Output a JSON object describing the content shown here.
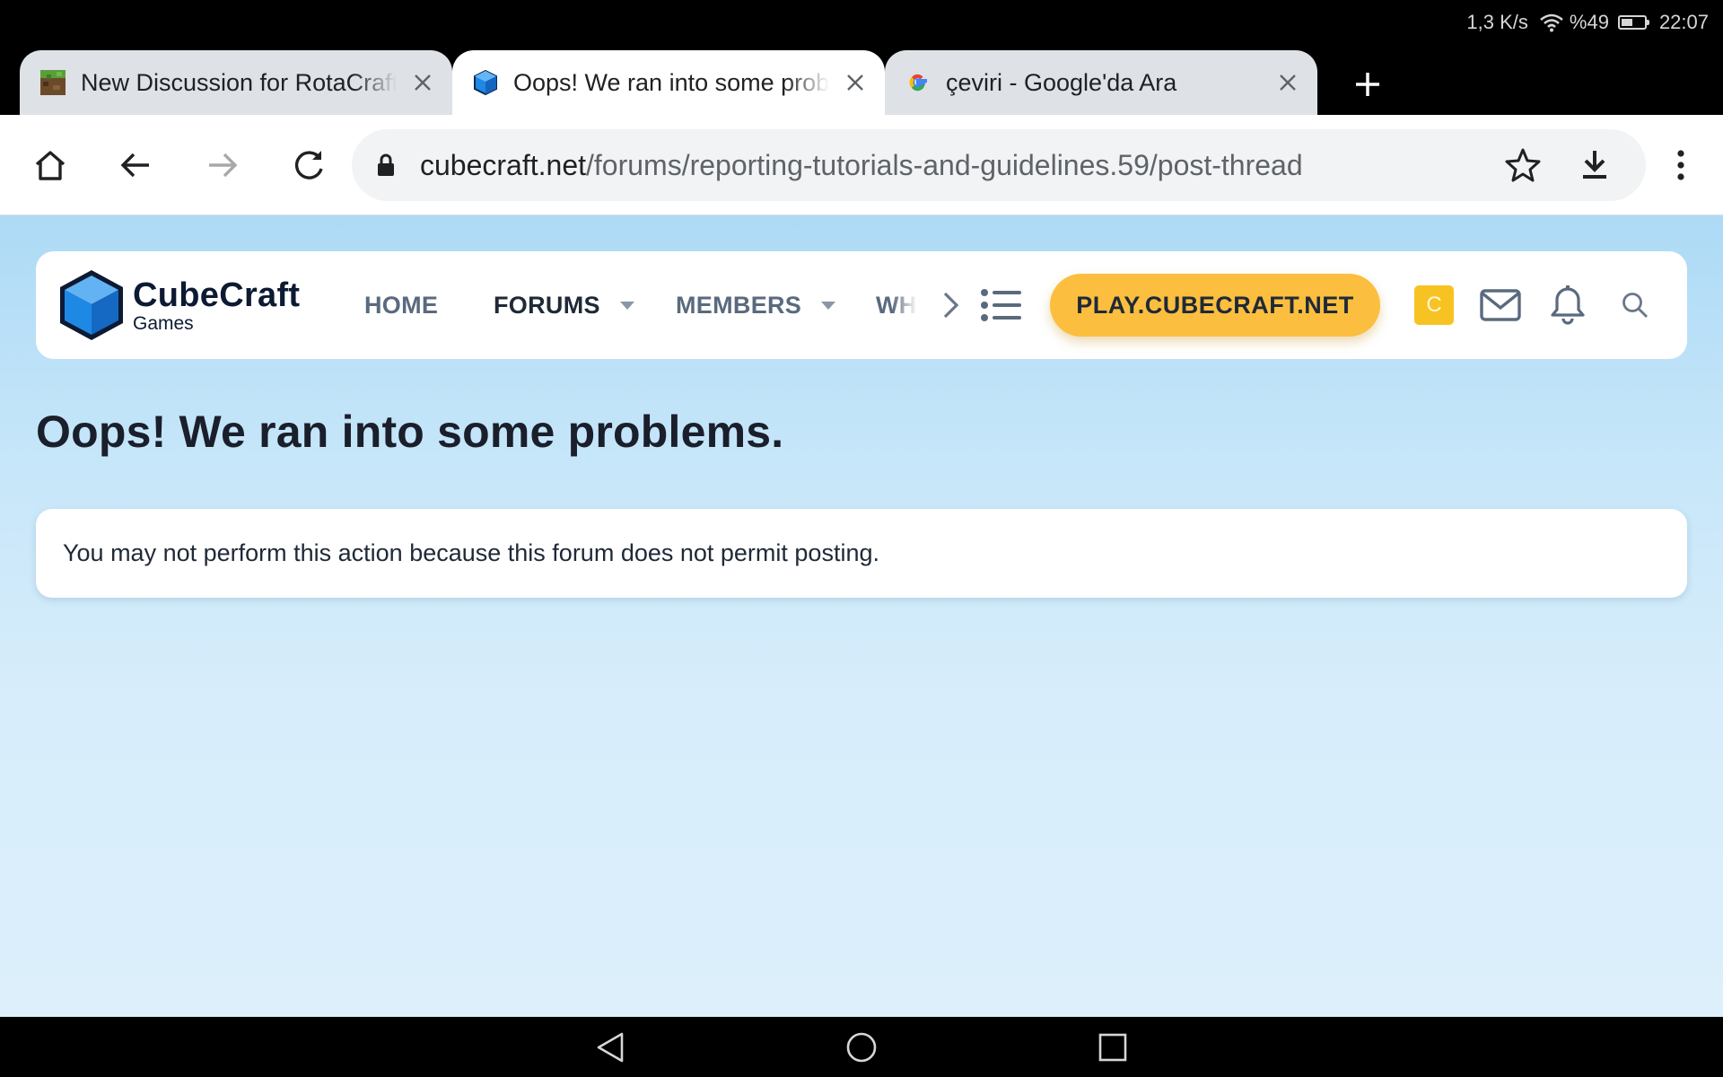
{
  "status_bar": {
    "network_speed": "1,3 K/s",
    "battery_percent": "%49",
    "battery_level": 0.49,
    "time": "22:07",
    "icons": [
      "wifi-icon",
      "battery-icon"
    ]
  },
  "tabs": [
    {
      "title": "New Discussion for RotaCraft",
      "favicon": "minecraft-block-icon",
      "active": false
    },
    {
      "title": "Oops! We ran into some problems.",
      "favicon": "cubecraft-cube-icon",
      "active": true
    },
    {
      "title": "çeviri - Google'da Ara",
      "favicon": "google-g-icon",
      "active": false
    }
  ],
  "toolbar": {
    "url_host": "cubecraft.net",
    "url_path": "/forums/reporting-tutorials-and-guidelines.59/post-thread",
    "icons": [
      "home-icon",
      "back-icon",
      "forward-icon",
      "reload-icon",
      "lock-icon",
      "star-icon",
      "download-icon",
      "more-vert-icon"
    ]
  },
  "site": {
    "logo_name": "CubeCraft",
    "logo_sub": "Games",
    "nav": [
      {
        "label": "HOME"
      },
      {
        "label": "FORUMS"
      },
      {
        "label": "MEMBERS"
      },
      {
        "label": "WHAT'S NEW"
      }
    ],
    "play_label": "PLAY.CUBECRAFT.NET",
    "coin_label": "C",
    "brand_colors": {
      "cube_blue": "#1e88e5",
      "play_yellow": "#fbbe3e",
      "coin_yellow": "#f7c322"
    }
  },
  "page": {
    "title": "Oops! We ran into some problems.",
    "error_message": "You may not perform this action because this forum does not permit posting."
  }
}
